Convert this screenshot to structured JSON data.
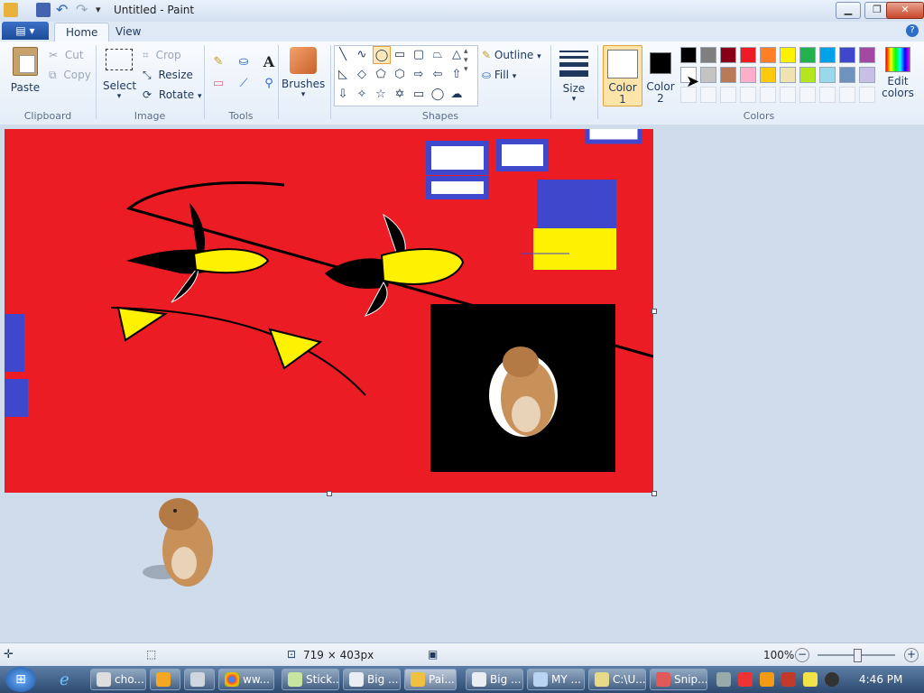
{
  "window": {
    "title": "Untitled - Paint"
  },
  "tabs": {
    "app_menu": "",
    "home": "Home",
    "view": "View"
  },
  "clipboard": {
    "paste": "Paste",
    "cut": "Cut",
    "copy": "Copy",
    "label": "Clipboard"
  },
  "image": {
    "select": "Select",
    "crop": "Crop",
    "resize": "Resize",
    "rotate": "Rotate",
    "label": "Image"
  },
  "tools": {
    "label": "Tools",
    "text_tool": "A"
  },
  "brushes": {
    "label": "Brushes"
  },
  "shapes": {
    "outline": "Outline",
    "fill": "Fill",
    "label": "Shapes"
  },
  "size": {
    "label": "Size"
  },
  "colors": {
    "color1_line1": "Color",
    "color1_line2": "1",
    "color2_line1": "Color",
    "color2_line2": "2",
    "edit_line1": "Edit",
    "edit_line2": "colors",
    "label": "Colors",
    "color1_value": "#ffffff",
    "color2_value": "#000000",
    "palette_row1": [
      "#000000",
      "#7f7f7f",
      "#880015",
      "#ed1c24",
      "#ff7f27",
      "#fff200",
      "#22b14c",
      "#00a2e8",
      "#3f48cc",
      "#a349a4"
    ],
    "palette_row2": [
      "#ffffff",
      "#c3c3c3",
      "#b97a57",
      "#ffaec9",
      "#ffc90e",
      "#efe4b0",
      "#b5e61d",
      "#99d9ea",
      "#7092be",
      "#c8bfe7"
    ]
  },
  "status": {
    "dimensions": "719 × 403px",
    "zoom": "100%"
  },
  "taskbar": {
    "buttons": [
      "cho...",
      "",
      "",
      "ww...",
      "Stick...",
      "Big ...",
      "Pai...",
      "Big ...",
      "MY ...",
      "C:\\U...",
      "Snip..."
    ],
    "clock": "4:46 PM"
  }
}
